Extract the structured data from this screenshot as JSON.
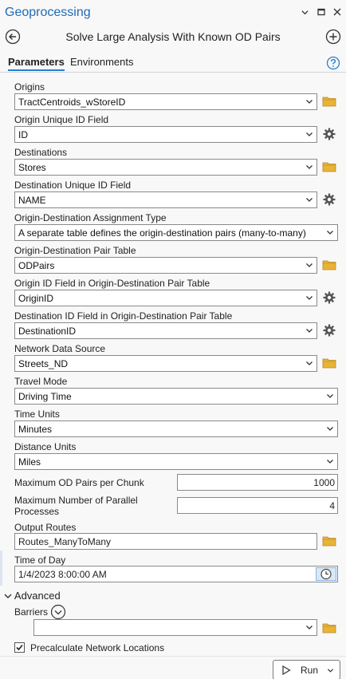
{
  "window": {
    "title": "Geoprocessing"
  },
  "tool": {
    "title": "Solve Large Analysis With Known OD Pairs"
  },
  "tabs": {
    "parameters": "Parameters",
    "environments": "Environments"
  },
  "params": {
    "origins": {
      "label": "Origins",
      "value": "TractCentroids_wStoreID"
    },
    "origin_uid": {
      "label": "Origin Unique ID Field",
      "value": "ID"
    },
    "destinations": {
      "label": "Destinations",
      "value": "Stores"
    },
    "dest_uid": {
      "label": "Destination Unique ID Field",
      "value": "NAME"
    },
    "od_assign_type": {
      "label": "Origin-Destination Assignment Type",
      "value": "A separate table defines the origin-destination pairs (many-to-many)"
    },
    "od_pair_table": {
      "label": "Origin-Destination Pair Table",
      "value": "ODPairs"
    },
    "origin_id_field": {
      "label": "Origin ID Field in Origin-Destination Pair Table",
      "value": "OriginID"
    },
    "dest_id_field": {
      "label": "Destination ID Field in Origin-Destination Pair Table",
      "value": "DestinationID"
    },
    "network": {
      "label": "Network Data Source",
      "value": "Streets_ND"
    },
    "travel_mode": {
      "label": "Travel Mode",
      "value": "Driving Time"
    },
    "time_units": {
      "label": "Time Units",
      "value": "Minutes"
    },
    "distance_units": {
      "label": "Distance Units",
      "value": "Miles"
    },
    "max_pairs": {
      "label": "Maximum OD Pairs per Chunk",
      "value": "1000"
    },
    "max_processes": {
      "label_line1": "Maximum Number of Parallel",
      "label_line2": "Processes",
      "value": "4"
    },
    "output_routes": {
      "label": "Output Routes",
      "value": "Routes_ManyToMany"
    },
    "time_of_day": {
      "label": "Time of Day",
      "value": "1/4/2023 8:00:00 AM"
    }
  },
  "advanced": {
    "label": "Advanced",
    "barriers_label": "Barriers",
    "barriers_value": "",
    "precalc_label": "Precalculate Network Locations",
    "precalc_checked": true
  },
  "run": {
    "label": "Run"
  },
  "colors": {
    "accent": "#2a7dd1",
    "title": "#1f6bb5",
    "folder": "#e8b436",
    "gear": "#555555"
  }
}
